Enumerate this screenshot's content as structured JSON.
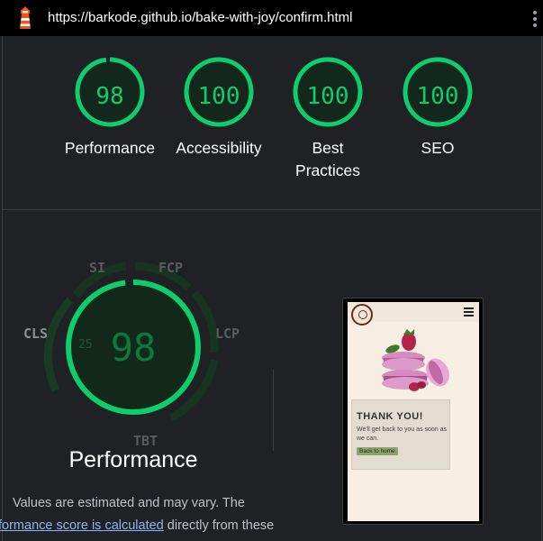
{
  "topbar": {
    "url": "https://barkode.github.io/bake-with-joy/confirm.html",
    "icon": "lighthouse-icon",
    "menu_icon": "kebab-menu-icon"
  },
  "colors": {
    "pass": "#0cce6b",
    "background": "#202124",
    "link": "#8ab4f8"
  },
  "scores": [
    {
      "value": "98",
      "label": "Performance",
      "fraction": 0.98
    },
    {
      "value": "100",
      "label": "Accessibility",
      "fraction": 1.0
    },
    {
      "value": "100",
      "label": "Best Practices",
      "fraction": 1.0
    },
    {
      "value": "100",
      "label": "SEO",
      "fraction": 1.0
    }
  ],
  "performance": {
    "score": "98",
    "title": "Performance",
    "metrics": {
      "si": "SI",
      "fcp": "FCP",
      "lcp": "LCP",
      "tbt": "TBT",
      "cls": "CLS"
    },
    "cls_weight": "25",
    "note_line1": "Values are estimated and may vary. The",
    "note_link": "formance score is calculated",
    "note_line2_rest": " directly from these"
  },
  "thumbnail": {
    "heading": "THANK YOU!",
    "text": "We'll get back to you as soon as we can.",
    "button": "Back to home",
    "menu_icon": "hamburger-icon",
    "logo_icon": "logo-icon"
  }
}
